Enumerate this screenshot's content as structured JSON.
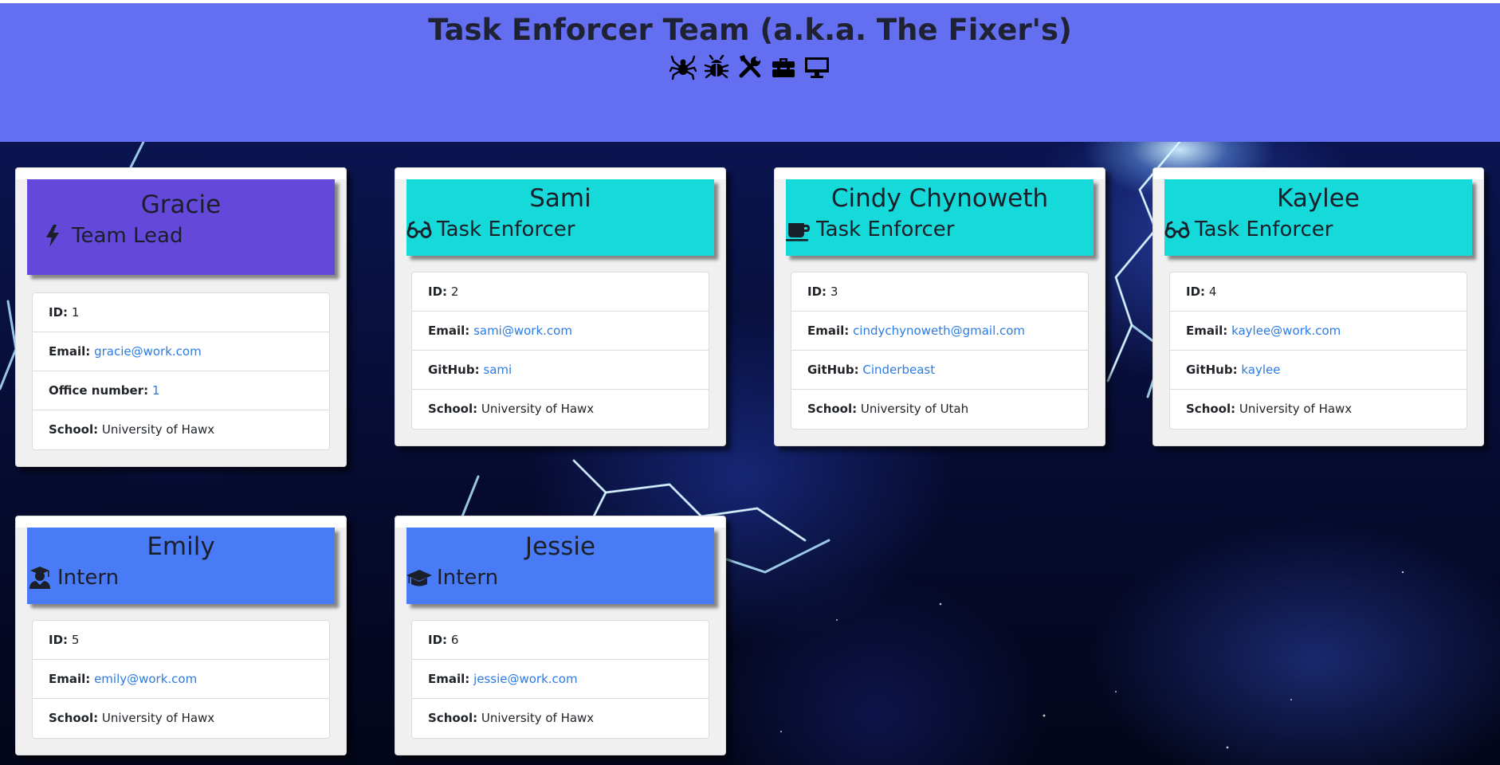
{
  "header": {
    "title": "Task Enforcer Team (a.k.a. The Fixer's)",
    "bg_color": "#636ef0",
    "icons": [
      "spider-icon",
      "bug-icon",
      "tools-icon",
      "toolbox-icon",
      "desktop-icon"
    ]
  },
  "cards": [
    {
      "name": "Gracie",
      "role": "Team Lead",
      "role_icon": "bolt-icon",
      "head_color": "#6348d9",
      "id_label": "ID:",
      "id": "1",
      "email_label": "Email:",
      "email": "gracie@work.com",
      "extra_label": "Office number:",
      "extra": "1",
      "school_label": "School:",
      "school": "University of Hawx"
    },
    {
      "name": "Sami",
      "role": "Task Enforcer",
      "role_icon": "glasses-icon",
      "head_color": "#16d9d9",
      "id_label": "ID:",
      "id": "2",
      "email_label": "Email:",
      "email": "sami@work.com",
      "extra_label": "GitHub:",
      "extra": "sami",
      "school_label": "School:",
      "school": "University of Hawx"
    },
    {
      "name": "Cindy Chynoweth",
      "role": "Task Enforcer",
      "role_icon": "coffee-icon",
      "head_color": "#16d9d9",
      "id_label": "ID:",
      "id": "3",
      "email_label": "Email:",
      "email": "cindychynoweth@gmail.com",
      "extra_label": "GitHub:",
      "extra": "Cinderbeast",
      "school_label": "School:",
      "school": "University of Utah"
    },
    {
      "name": "Kaylee",
      "role": "Task Enforcer",
      "role_icon": "glasses-icon",
      "head_color": "#16d9d9",
      "id_label": "ID:",
      "id": "4",
      "email_label": "Email:",
      "email": "kaylee@work.com",
      "extra_label": "GitHub:",
      "extra": "kaylee",
      "school_label": "School:",
      "school": "University of Hawx"
    },
    {
      "name": "Emily",
      "role": "Intern",
      "role_icon": "student-icon",
      "head_color": "#4a7bf7",
      "id_label": "ID:",
      "id": "5",
      "email_label": "Email:",
      "email": "emily@work.com",
      "school_label": "School:",
      "school": "University of Hawx"
    },
    {
      "name": "Jessie",
      "role": "Intern",
      "role_icon": "graduation-cap-icon",
      "head_color": "#4a7bf7",
      "id_label": "ID:",
      "id": "6",
      "email_label": "Email:",
      "email": "jessie@work.com",
      "school_label": "School:",
      "school": "University of Hawx"
    }
  ]
}
